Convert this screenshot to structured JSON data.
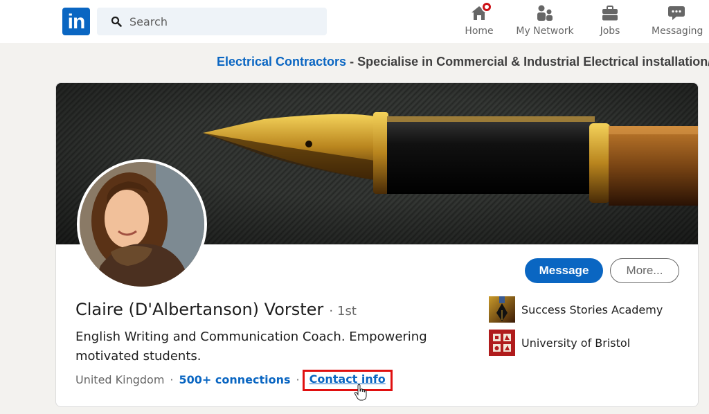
{
  "header": {
    "logo_text": "in",
    "search": {
      "placeholder": "Search",
      "icon": "search-icon"
    },
    "nav": [
      {
        "label": "Home",
        "icon": "home-icon",
        "has_notification": true
      },
      {
        "label": "My Network",
        "icon": "people-icon"
      },
      {
        "label": "Jobs",
        "icon": "briefcase-icon"
      },
      {
        "label": "Messaging",
        "icon": "chat-bubble-icon"
      }
    ]
  },
  "ad_banner": {
    "link_text": "Electrical Contractors",
    "separator": " - ",
    "text": "Specialise in Commercial & Industrial Electrical installation/m"
  },
  "profile": {
    "name": "Claire (D'Albertanson) Vorster",
    "separator": "·",
    "degree": "1st",
    "headline": "English Writing and Communication Coach. Empowering motivated students.",
    "location": "United Kingdom",
    "dot": "·",
    "connections": "500+ connections",
    "contact_info": "Contact info",
    "highlight_color": "#e01010",
    "actions": {
      "message": "Message",
      "more": "More..."
    },
    "organizations": [
      {
        "name": "Success Stories Academy",
        "icon": "pen-nib-logo-icon"
      },
      {
        "name": "University of Bristol",
        "icon": "university-crest-icon"
      }
    ]
  },
  "colors": {
    "brand": "#0a66c2",
    "background": "#f3f2ef",
    "notification": "#cc1016"
  }
}
